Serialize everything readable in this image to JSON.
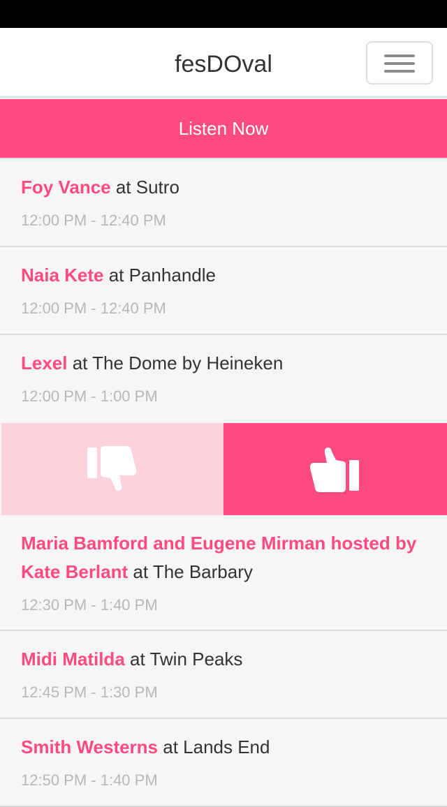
{
  "header": {
    "title": "fesDOval",
    "menu_icon": "hamburger-menu-icon"
  },
  "banner": {
    "label": "Listen Now"
  },
  "colors": {
    "accent": "#ff4a82",
    "accent_light": "#ffd1dd",
    "background": "#f6f6f6",
    "time_text": "#b8b8b8"
  },
  "schedule": [
    {
      "artist": "Foy Vance",
      "stage_text": " at Sutro",
      "time": "12:00 PM - 12:40 PM"
    },
    {
      "artist": "Naia Kete",
      "stage_text": " at Panhandle",
      "time": "12:00 PM - 12:40 PM"
    },
    {
      "artist": "Lexel",
      "stage_text": " at The Dome by Heineken",
      "time": "12:00 PM - 1:00 PM"
    },
    {
      "artist": "Maria Bamford and Eugene Mirman hosted by Kate Berlant",
      "stage_text": " at The Barbary",
      "time": "12:30 PM - 1:40 PM"
    },
    {
      "artist": "Midi Matilda",
      "stage_text": " at Twin Peaks",
      "time": "12:45 PM - 1:30 PM"
    },
    {
      "artist": "Smith Westerns",
      "stage_text": " at Lands End",
      "time": "12:50 PM - 1:40 PM"
    }
  ],
  "vote": {
    "down_icon": "thumbs-down-icon",
    "up_icon": "thumbs-up-icon"
  }
}
